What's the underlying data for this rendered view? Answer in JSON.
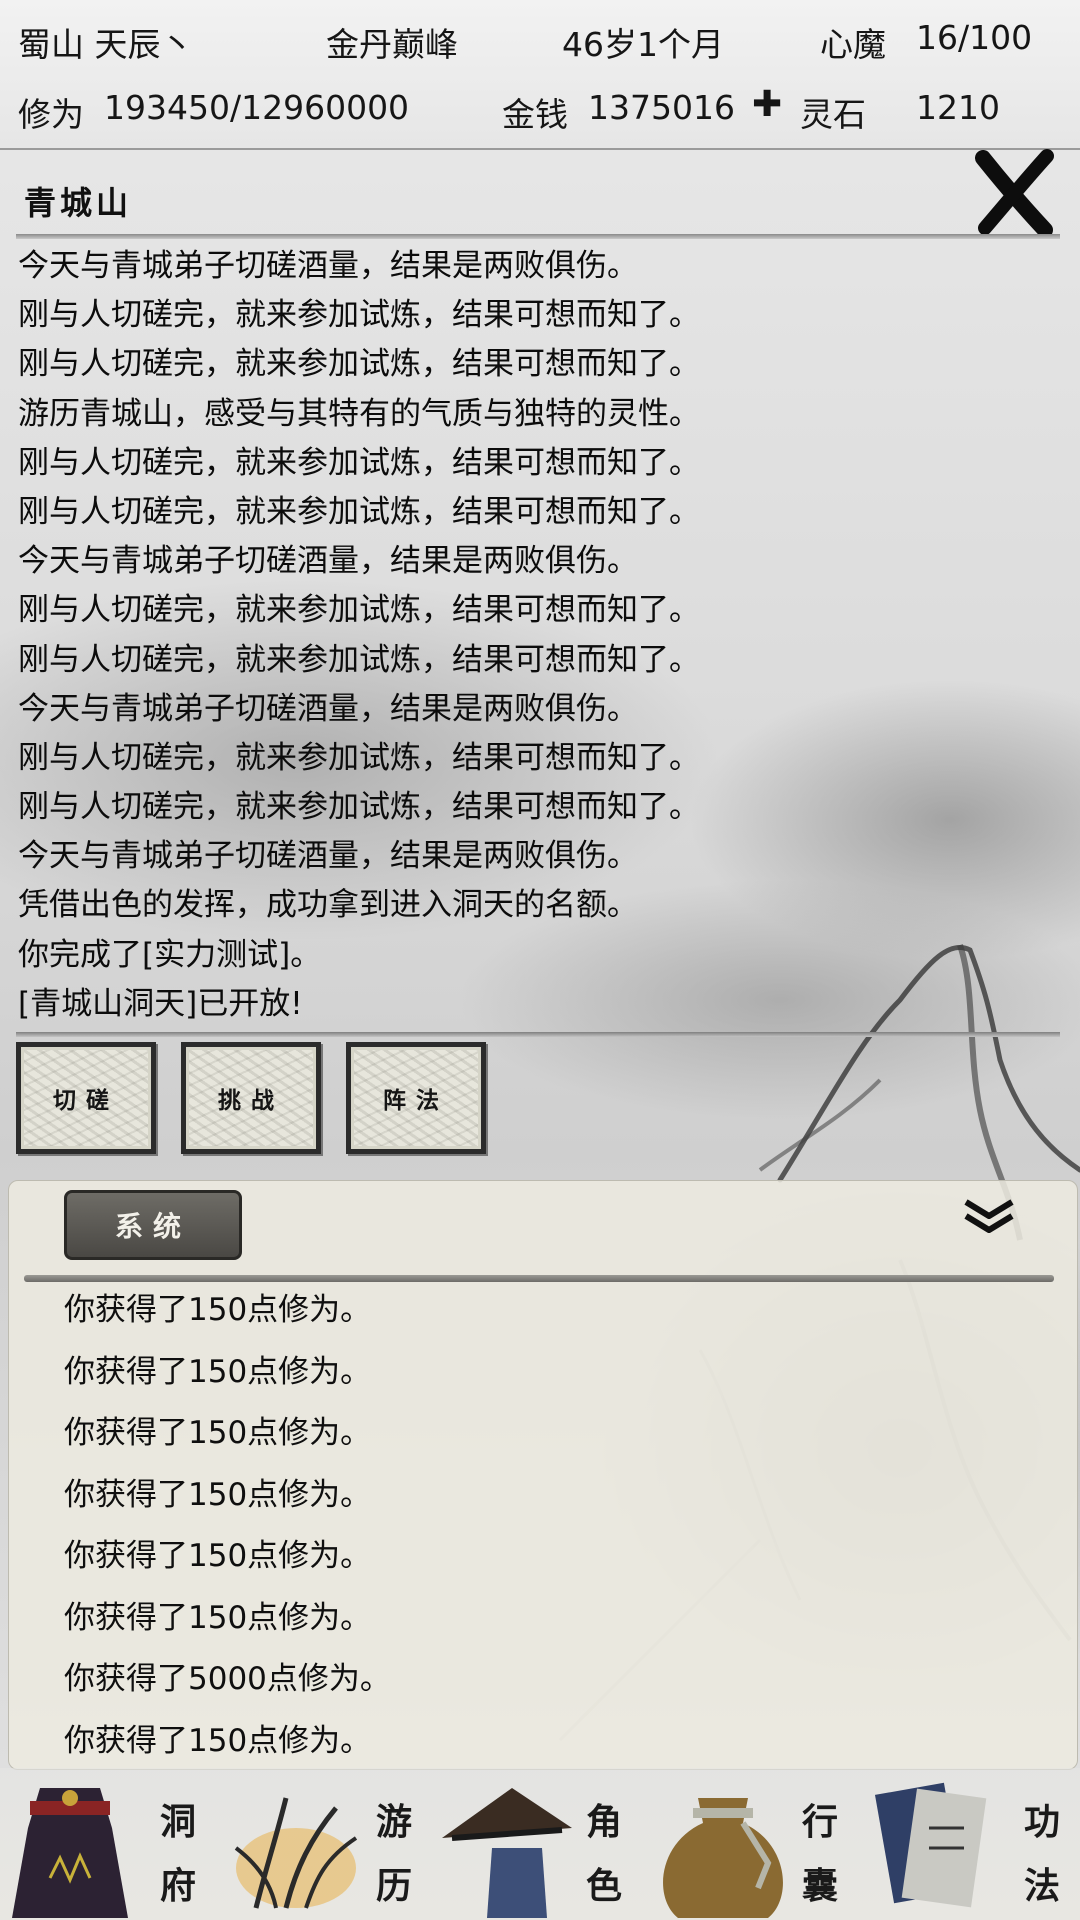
{
  "header": {
    "name": "蜀山 天辰丶",
    "realm": "金丹巅峰",
    "age": "46岁1个月",
    "demon_label": "心魔",
    "demon_value": "16/100",
    "cultivation_label": "修为",
    "cultivation_value": "193450/12960000",
    "money_label": "金钱",
    "money_value": "1375016",
    "stone_label": "灵石",
    "stone_value": "1210",
    "stone_icon": "diamond-icon"
  },
  "location": {
    "title": "青城山",
    "close_icon": "close-x-icon"
  },
  "event_log": [
    "今天与青城弟子切磋酒量，结果是两败俱伤。",
    "刚与人切磋完，就来参加试炼，结果可想而知了。",
    "刚与人切磋完，就来参加试炼，结果可想而知了。",
    "游历青城山，感受与其特有的气质与独特的灵性。",
    "刚与人切磋完，就来参加试炼，结果可想而知了。",
    "刚与人切磋完，就来参加试炼，结果可想而知了。",
    "今天与青城弟子切磋酒量，结果是两败俱伤。",
    "刚与人切磋完，就来参加试炼，结果可想而知了。",
    "刚与人切磋完，就来参加试炼，结果可想而知了。",
    "今天与青城弟子切磋酒量，结果是两败俱伤。",
    "刚与人切磋完，就来参加试炼，结果可想而知了。",
    "刚与人切磋完，就来参加试炼，结果可想而知了。",
    "今天与青城弟子切磋酒量，结果是两败俱伤。",
    "凭借出色的发挥，成功拿到进入洞天的名额。",
    "你完成了[实力测试]。",
    "[青城山洞天]已开放!"
  ],
  "actions": [
    "切磋",
    "挑战",
    "阵法"
  ],
  "system_panel": {
    "tab_label": "系统",
    "collapse_icon": "double-chevron-down-icon",
    "messages": [
      "你获得了150点修为。",
      "你获得了150点修为。",
      "你获得了150点修为。",
      "你获得了150点修为。",
      "你获得了150点修为。",
      "你获得了150点修为。",
      "你获得了5000点修为。",
      "你获得了150点修为。"
    ]
  },
  "nav": [
    {
      "label_top": "洞",
      "label_bottom": "府",
      "icon": "cave-robe-icon"
    },
    {
      "label_top": "游",
      "label_bottom": "历",
      "icon": "travel-grass-icon"
    },
    {
      "label_top": "角",
      "label_bottom": "色",
      "icon": "character-hat-icon"
    },
    {
      "label_top": "行",
      "label_bottom": "囊",
      "icon": "bag-icon"
    },
    {
      "label_top": "功",
      "label_bottom": "法",
      "icon": "scroll-books-icon"
    }
  ]
}
